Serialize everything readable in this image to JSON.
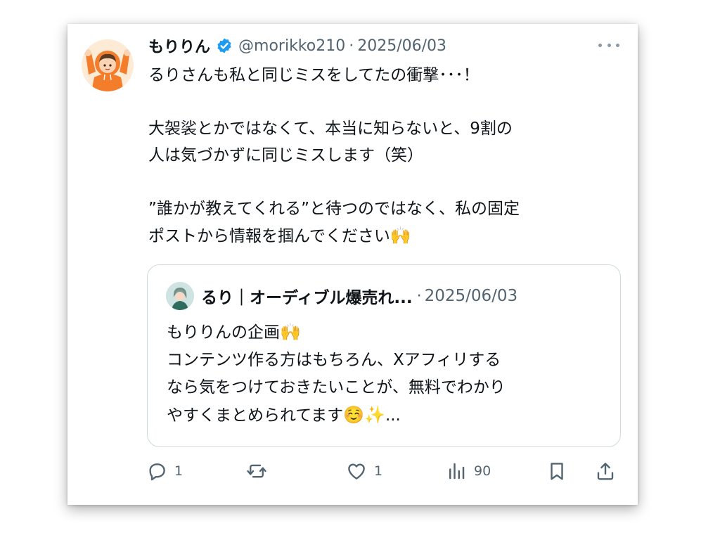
{
  "post": {
    "author_name": "もりりん",
    "handle": "@morikko210",
    "separator": "·",
    "date": "2025/06/03",
    "body_text": "るりさんも私と同じミスをしてたの衝撃･･･！\n\n大袈裟とかではなくて、本当に知らないと、9割の\n人は気づかずに同じミスします（笑）\n\n”誰かが教えてくれる”と待つのではなく、私の固定\nポストから情報を掴んでください",
    "body_emoji": "🙌"
  },
  "quoted_post": {
    "author_name": "るり｜オーディブル爆売れ...",
    "separator": "·",
    "date": "2025/06/03",
    "line1": "もりりんの企画",
    "line1_emoji": "🙌",
    "text_rest": "コンテンツ作る方はもちろん、Xアフィリする\nなら気をつけておきたいことが、無料でわかり\nやすくまとめられてます",
    "trailing_emoji": "☺️✨",
    "ellipsis": "..."
  },
  "actions": {
    "reply_count": "1",
    "like_count": "1",
    "views_count": "90"
  },
  "colors": {
    "text": "#0f1419",
    "muted": "#536471",
    "verified": "#1d9bf0",
    "border": "#cfd9de",
    "avatar_hoodie": "#f47d2b"
  },
  "icons": [
    "verified-badge-icon",
    "more-icon",
    "reply-icon",
    "repost-icon",
    "like-icon",
    "views-icon",
    "bookmark-icon",
    "share-icon"
  ]
}
